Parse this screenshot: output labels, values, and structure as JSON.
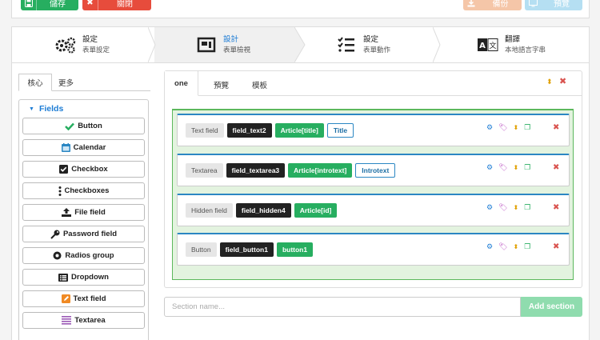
{
  "toolbar": {
    "save_label": "儲存",
    "close_label": "關閉",
    "backup_label": "備份",
    "preview_label": "預覽"
  },
  "steps": [
    {
      "title": "設定",
      "subtitle": "表單設定",
      "icon": "gears-icon"
    },
    {
      "title": "設計",
      "subtitle": "表單檢視",
      "icon": "layout-icon"
    },
    {
      "title": "設定",
      "subtitle": "表單動作",
      "icon": "checklist-icon"
    },
    {
      "title": "翻譯",
      "subtitle": "本地語言字串",
      "icon": "translate-icon"
    }
  ],
  "sidebar": {
    "tabs": [
      "核心",
      "更多"
    ],
    "group_title": "Fields",
    "fields": [
      {
        "label": "Button",
        "icon": "check-icon"
      },
      {
        "label": "Calendar",
        "icon": "calendar-icon"
      },
      {
        "label": "Checkbox",
        "icon": "checkbox-icon"
      },
      {
        "label": "Checkboxes",
        "icon": "vertical-dots-icon"
      },
      {
        "label": "File field",
        "icon": "upload-icon"
      },
      {
        "label": "Password field",
        "icon": "key-icon"
      },
      {
        "label": "Radios group",
        "icon": "radio-icon"
      },
      {
        "label": "Dropdown",
        "icon": "list-icon"
      },
      {
        "label": "Text field",
        "icon": "pencil-icon"
      },
      {
        "label": "Textarea",
        "icon": "lines-icon"
      }
    ]
  },
  "content": {
    "tabs": [
      "one",
      "預覽",
      "模板"
    ],
    "rows": [
      {
        "type": "Text field",
        "name": "field_text2",
        "bind": "Article[title]",
        "label": "Title"
      },
      {
        "type": "Textarea",
        "name": "field_textarea3",
        "bind": "Article[introtext]",
        "label": "Introtext"
      },
      {
        "type": "Hidden field",
        "name": "field_hidden4",
        "bind": "Article[id]",
        "label": ""
      },
      {
        "type": "Button",
        "name": "field_button1",
        "bind": "button1",
        "label": ""
      }
    ]
  },
  "section": {
    "placeholder": "Section name...",
    "add_label": "Add section"
  },
  "colors": {
    "accent": "#1c7cd5",
    "success": "#27ae60",
    "danger": "#e74c3c",
    "dark": "#222222"
  }
}
